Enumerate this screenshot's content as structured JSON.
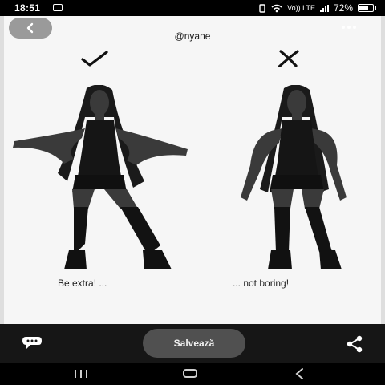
{
  "status_bar": {
    "time": "18:51",
    "network_label": "Vo)) LTE",
    "battery_percent": "72%"
  },
  "header": {
    "username": "@nyane"
  },
  "pin": {
    "left": {
      "mark": "check-mark",
      "caption": "Be extra! ..."
    },
    "right": {
      "mark": "cross-mark",
      "caption": "... not boring!"
    }
  },
  "actions": {
    "save_label": "Salvează"
  },
  "icons": {
    "back": "arrow-left-icon",
    "more": "more-icon",
    "comment": "comment-icon",
    "share": "share-icon",
    "nav_recents": "recents-icon",
    "nav_home": "home-icon",
    "nav_back": "back-chevron-icon"
  },
  "colors": {
    "card_background": "#f6f6f6",
    "action_bar": "#161616",
    "save_button": "#505050"
  }
}
